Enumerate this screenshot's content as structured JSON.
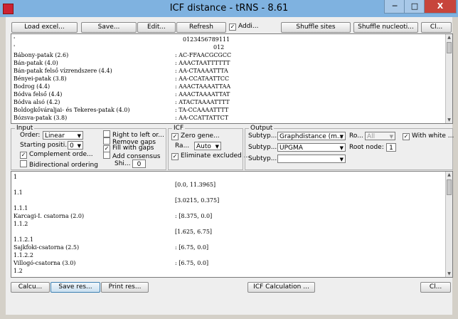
{
  "window": {
    "title": "ICF distance - tRNS - 8.61",
    "min_label": "─",
    "max_label": "□",
    "close_label": "X"
  },
  "toolbar": {
    "load_excel": "Load excel...",
    "save": "Save...",
    "edit": "Edit...",
    "refresh": "Refresh",
    "addi_label": "Addi...",
    "shuffle_sites": "Shuffle sites",
    "shuffle_nucleoti": "Shuffle nucleoti...",
    "close": "Cl..."
  },
  "sequences": {
    "ruler1": "0123456789111",
    "ruler2": "012",
    "rows": [
      {
        "name": "Bábony-patak (2.6)",
        "seq": ": AC-FFAACGCGCC"
      },
      {
        "name": "Bán-patak (4.0)",
        "seq": ": AAACTAATTTTTT"
      },
      {
        "name": "Bán-patak felső vízrendszere (4.4)",
        "seq": ": AA-CTAAAATTTA"
      },
      {
        "name": "Bényei-patak (3.8)",
        "seq": ": AA-CCATAATTCC"
      },
      {
        "name": "Bodrog (4.4)",
        "seq": ": AAACTAAAATTAA"
      },
      {
        "name": "Bódva felső (4.4)",
        "seq": ": AAACTAAAATTAT"
      },
      {
        "name": "Bódva alsó (4.2)",
        "seq": ": ATACTAAAATTTT"
      },
      {
        "name": "Boldogkőváraljai- és Tekeres-patak (4.0)",
        "seq": ": TA-CCAAAATTTT"
      },
      {
        "name": "Bózsva-patak (3.8)",
        "seq": ": AA-CCATTATTCT"
      }
    ]
  },
  "input": {
    "title": "Input",
    "order_label": "Order:",
    "order_value": "Linear",
    "starting_label": "Starting positi...",
    "starting_value": "0",
    "complement_label": "Complement orde...",
    "bidirectional_label": "Bidirectional ordering",
    "right_to_left_label": "Right to left or...",
    "remove_gaps_label": "Remove gaps",
    "fill_gaps_label": "Fill with gaps",
    "add_consensus_label": "Add consensus",
    "shi_label": "Shi...",
    "shi_value": "0"
  },
  "icf": {
    "title": "ICF",
    "zero_gene_label": "Zero gene...",
    "ra_label": "Ra...",
    "ra_value": "Auto",
    "eliminate_label": "Eliminate excluded ..."
  },
  "output": {
    "title": "Output",
    "subtype_label": "Subtyp...",
    "subtype1_value": "Graphdistance (m...",
    "subtype2_value": "UPGMA",
    "subtype3_value": "",
    "ro_label": "Ro...",
    "ro_value": "All",
    "with_white_label": "With white ...",
    "root_node_label": "Root node:",
    "root_node_value": "1"
  },
  "results": {
    "lines": [
      {
        "left": "1",
        "right": ""
      },
      {
        "left": "",
        "right": "[0.0, 11.3965]"
      },
      {
        "left": "1.1",
        "right": ""
      },
      {
        "left": "",
        "right": "[3.0215, 0.375]"
      },
      {
        "left": "1.1.1",
        "right": ""
      },
      {
        "left": "Karcagi-I. csatorna (2.0)",
        "right": ": [8.375, 0.0]"
      },
      {
        "left": "1.1.2",
        "right": ""
      },
      {
        "left": "",
        "right": "[1.625, 6.75]"
      },
      {
        "left": "1.1.2.1",
        "right": ""
      },
      {
        "left": "Sajkfoki-csatorna (2.5)",
        "right": ": [6.75, 0.0]"
      },
      {
        "left": "1.1.2.2",
        "right": ""
      },
      {
        "left": "Villogó-csatorna (3.0)",
        "right": ": [6.75, 0.0]"
      },
      {
        "left": "1.2",
        "right": ""
      }
    ]
  },
  "bottombar": {
    "calcu": "Calcu...",
    "save_res": "Save res...",
    "print_res": "Print res...",
    "icf_calc": "ICF Calculation ...",
    "close": "Cl..."
  },
  "checks": {
    "addi": true,
    "complement": true,
    "bidirectional": false,
    "right_to_left": false,
    "remove_gaps": false,
    "fill_gaps": true,
    "add_consensus": false,
    "zero_gene": true,
    "eliminate": true,
    "with_white": true
  }
}
